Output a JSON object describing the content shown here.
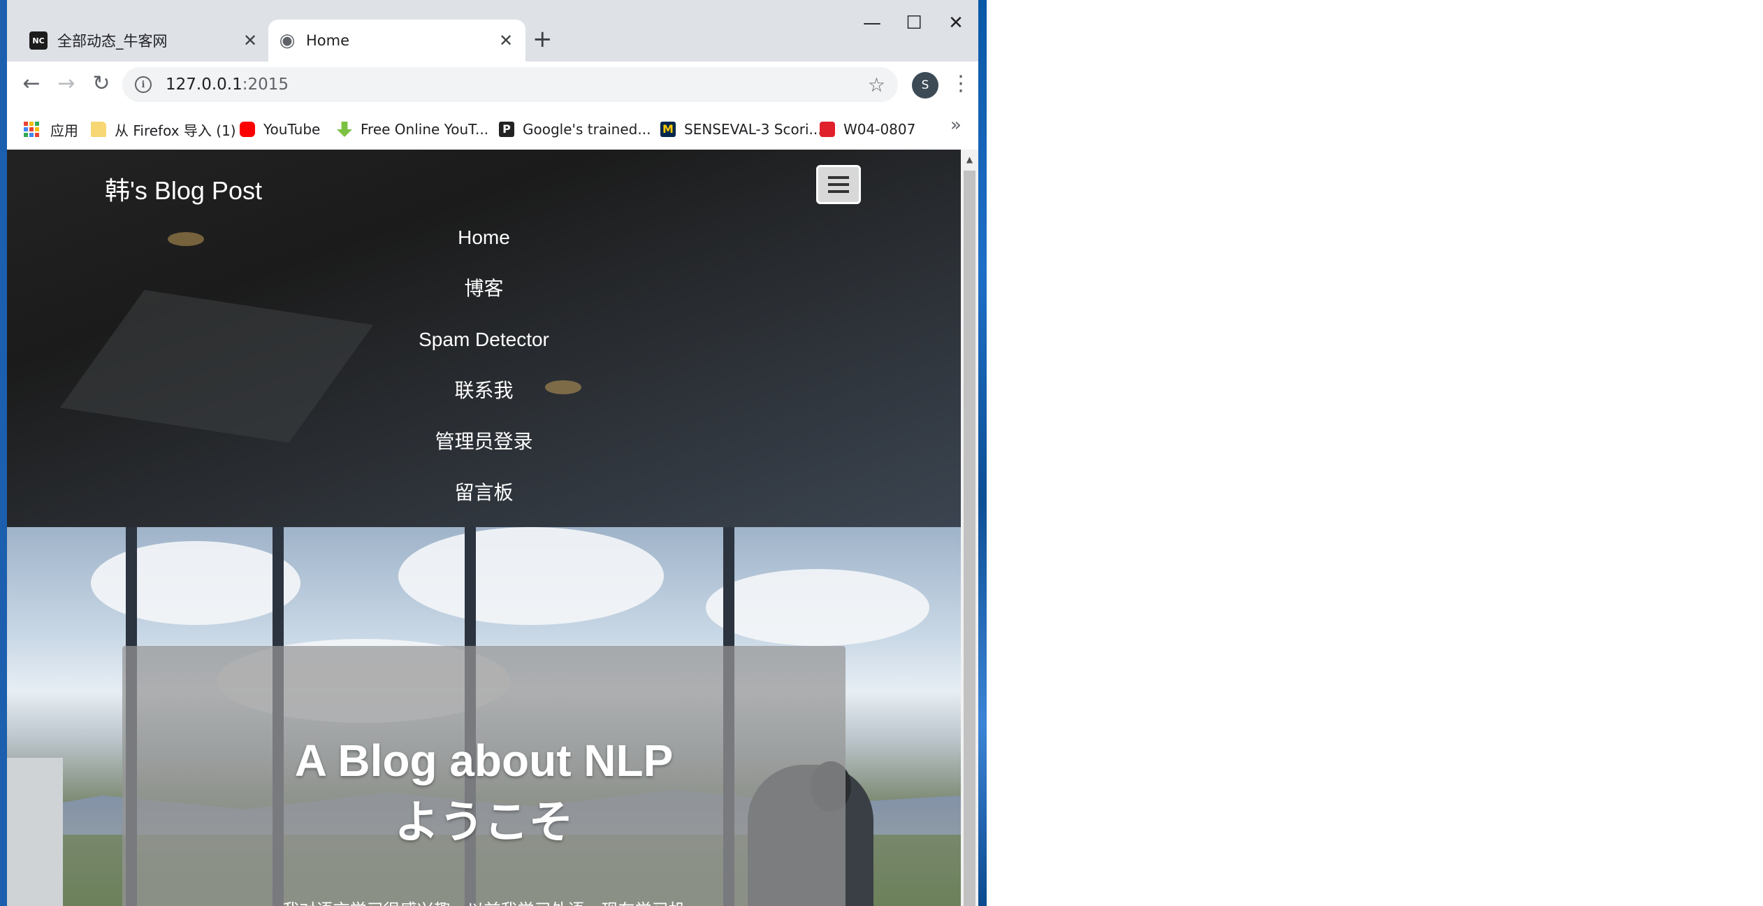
{
  "tabs": [
    {
      "title": "全部动态_牛客网",
      "favicon": "nowcoder-favicon",
      "favicon_text": "NC"
    },
    {
      "title": "Home",
      "favicon": "globe-icon"
    }
  ],
  "toolbar": {
    "url_host": "127.0.0.1",
    "url_port": ":2015",
    "profile_initial": "S"
  },
  "bookmarks": [
    {
      "label": "应用",
      "icon": "apps-icon"
    },
    {
      "label": "从 Firefox 导入 (1)",
      "icon": "folder-icon",
      "color": "#f7d774"
    },
    {
      "label": "YouTube",
      "icon": "youtube-icon",
      "color": "#ff0000"
    },
    {
      "label": "Free Online YouT...",
      "icon": "download-arrow-icon",
      "color": "#7cc242"
    },
    {
      "label": "Google's trained...",
      "icon": "p-icon",
      "color": "#222222"
    },
    {
      "label": "SENSEVAL-3 Scori...",
      "icon": "umich-icon",
      "color": "#00274c"
    },
    {
      "label": "W04-0807",
      "icon": "acrobat-icon",
      "color": "#e0202b"
    }
  ],
  "site": {
    "brand": "韩's Blog Post",
    "nav": [
      "Home",
      "博客",
      "Spam Detector",
      "联系我",
      "管理员登录",
      "留言板"
    ],
    "hero_title_line1": "A Blog about NLP",
    "hero_title_line2": "ようこそ",
    "hero_subtitle": "我对语言学习很感兴趣，以前我学习外语，现在学习机"
  },
  "colors": {
    "navbar_bg": "#1c1c1c",
    "hero_card_bg": "rgba(150,150,150,0.72)",
    "window_border": "#1b5fae"
  }
}
